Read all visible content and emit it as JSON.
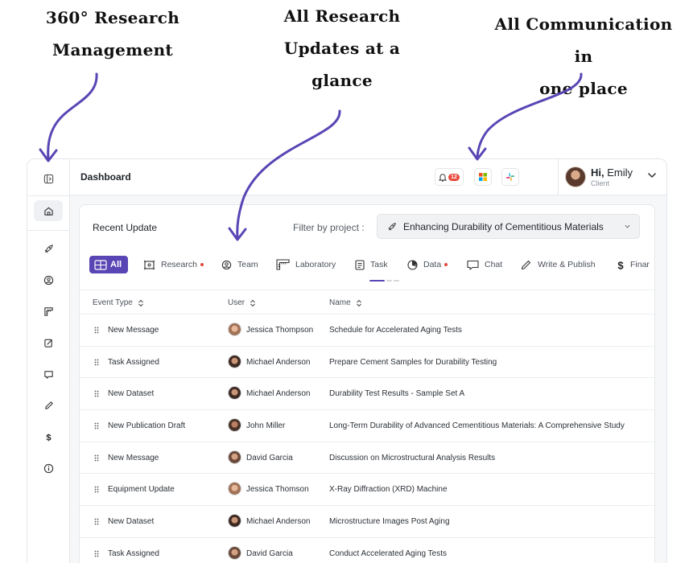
{
  "annotations": [
    {
      "lines": [
        "360° Research",
        "Management"
      ]
    },
    {
      "lines": [
        "All Research",
        "Updates at a",
        "glance"
      ]
    },
    {
      "lines": [
        "All Communication in",
        "one place"
      ]
    }
  ],
  "topbar": {
    "title": "Dashboard",
    "notification_count": "12",
    "greeting": "Hi,",
    "user_name": "Emily",
    "user_role": "Client"
  },
  "sidebar": {
    "items": [
      {
        "icon": "collapse-sidebar-icon"
      },
      {
        "icon": "home-icon",
        "active": true
      },
      {
        "icon": "rocket-icon"
      },
      {
        "icon": "team-icon"
      },
      {
        "icon": "laboratory-icon"
      },
      {
        "icon": "task-icon"
      },
      {
        "icon": "chat-icon"
      },
      {
        "icon": "write-icon"
      },
      {
        "icon": "finance-icon"
      },
      {
        "icon": "info-icon"
      }
    ]
  },
  "card": {
    "title": "Recent Update",
    "filter_label": "Filter by project :",
    "selected_project": "Enhancing Durability of Cementitious Materials"
  },
  "tabs": [
    {
      "label": "All",
      "icon": "grid-icon",
      "active": true
    },
    {
      "label": "Research",
      "icon": "research-icon",
      "dot": true
    },
    {
      "label": "Team",
      "icon": "team-icon"
    },
    {
      "label": "Laboratory",
      "icon": "laboratory-icon"
    },
    {
      "label": "Task",
      "icon": "task-icon"
    },
    {
      "label": "Data",
      "icon": "data-icon",
      "dot": true
    },
    {
      "label": "Chat",
      "icon": "chat-icon"
    },
    {
      "label": "Write & Publish",
      "icon": "write-icon"
    },
    {
      "label": "Finar",
      "icon": "finance-icon"
    }
  ],
  "table": {
    "columns": [
      "Event Type",
      "User",
      "Name"
    ],
    "rows": [
      {
        "event": "New Message",
        "user": "Jessica Thompson",
        "name": "Schedule for Accelerated Aging Tests"
      },
      {
        "event": "Task Assigned",
        "user": "Michael Anderson",
        "name": "Prepare Cement Samples for Durability Testing"
      },
      {
        "event": "New Dataset",
        "user": "Michael Anderson",
        "name": "Durability Test Results - Sample Set A"
      },
      {
        "event": "New Publication Draft",
        "user": "John Miller",
        "name": "Long-Term Durability of Advanced Cementitious Materials: A Comprehensive Study"
      },
      {
        "event": "New Message",
        "user": "David Garcia",
        "name": "Discussion on Microstructural Analysis Results"
      },
      {
        "event": "Equipment Update",
        "user": "Jessica Thomson",
        "name": "X-Ray Diffraction (XRD) Machine"
      },
      {
        "event": "New Dataset",
        "user": "Michael Anderson",
        "name": "Microstructure Images Post Aging"
      },
      {
        "event": "Task Assigned",
        "user": "David Garcia",
        "name": "Conduct Accelerated Aging Tests"
      }
    ]
  },
  "colors": {
    "accent": "#5a45b5",
    "annotation_arrow": "#5a45b5",
    "alert_dot": "#e2463a"
  }
}
